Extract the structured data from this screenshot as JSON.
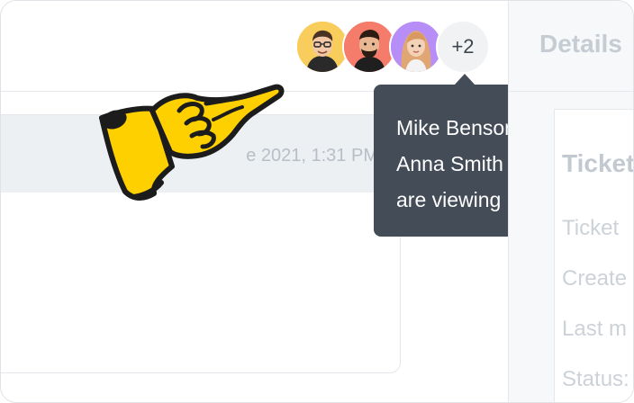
{
  "viewers": {
    "overflow_label": "+2",
    "tooltip_lines": [
      "Mike Benson",
      "Anna Smith",
      "are viewing"
    ],
    "avatar_colors": [
      "#f9cd5b",
      "#f57c6b",
      "#b78ef7"
    ]
  },
  "message": {
    "date": "e 2021, 1:31 PM"
  },
  "details": {
    "title": "Details",
    "ticket_heading": "Ticket",
    "fields": [
      "Ticket",
      "Create",
      "Last m",
      "Status:"
    ]
  },
  "icons": {
    "pointer": "pointing-hand-icon"
  }
}
